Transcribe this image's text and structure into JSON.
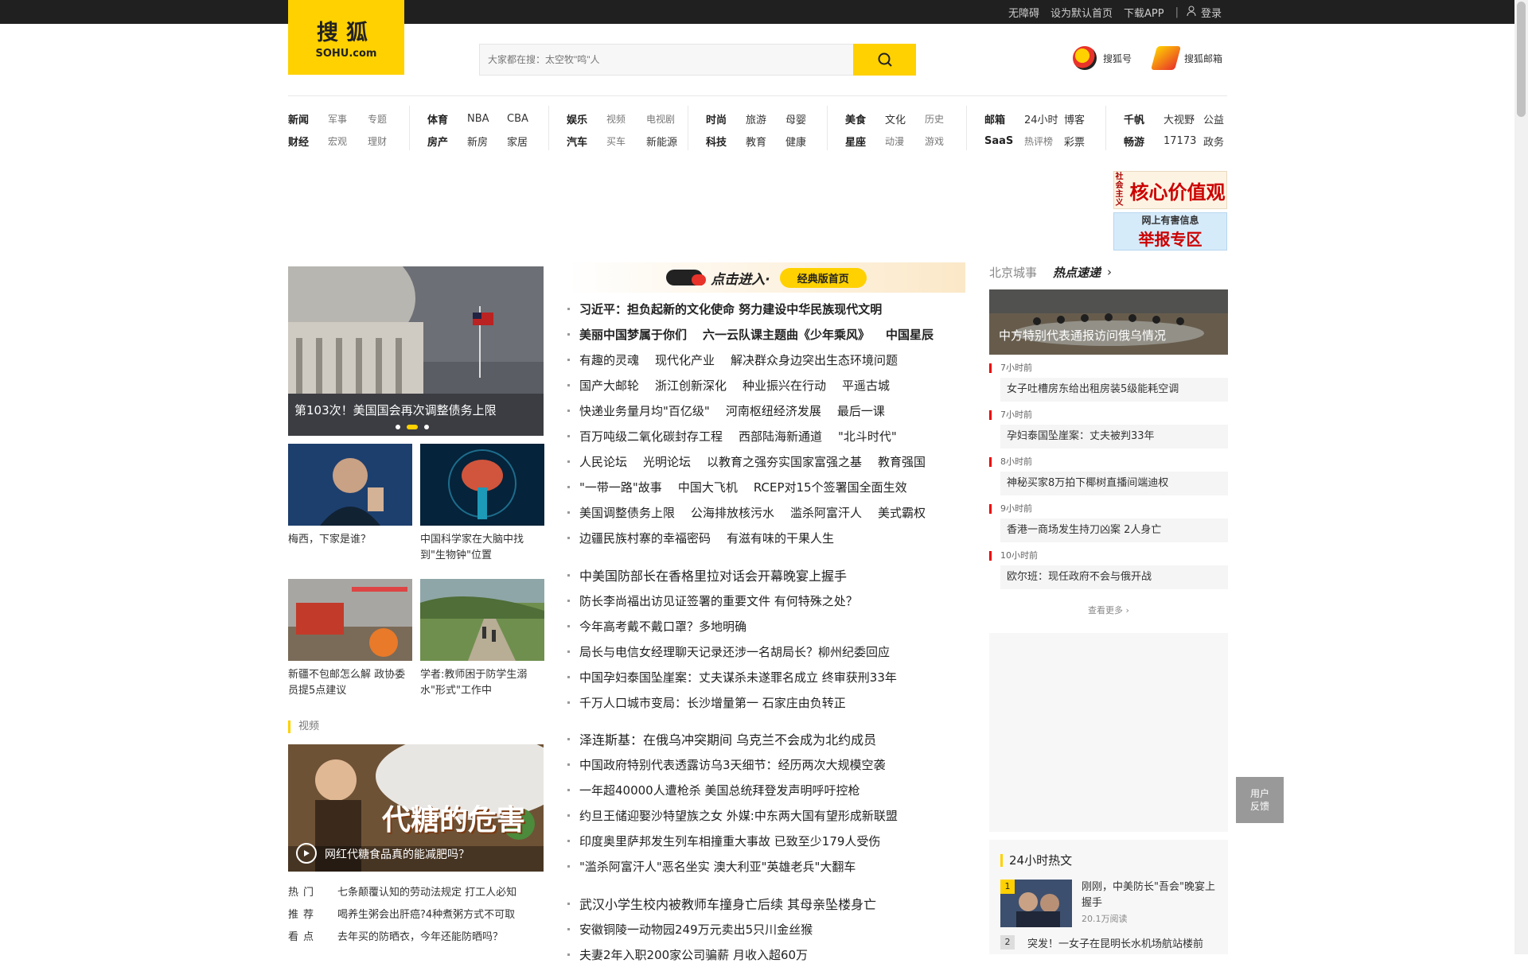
{
  "topbar": {
    "accessibility": "无障碍",
    "set_home": "设为默认首页",
    "download_app": "下载APP",
    "divider": "|",
    "login": "登录"
  },
  "logo": {
    "text": "搜狐",
    "sub": "SOHU.com"
  },
  "search": {
    "placeholder": "大家都在搜：太空牧\"鸣\"人",
    "icon": "search-icon"
  },
  "header_links": [
    {
      "label": "搜狐号",
      "icon": "sohu-hao-icon"
    },
    {
      "label": "搜狐邮箱",
      "icon": "sohu-mail-icon"
    }
  ],
  "nav": [
    [
      [
        "新闻",
        "军事",
        "专题"
      ],
      [
        "财经",
        "宏观",
        "理财"
      ]
    ],
    [
      [
        "体育",
        "NBA",
        "CBA"
      ],
      [
        "房产",
        "新房",
        "家居"
      ]
    ],
    [
      [
        "娱乐",
        "视频",
        "电视剧"
      ],
      [
        "汽车",
        "买车",
        "新能源"
      ]
    ],
    [
      [
        "时尚",
        "旅游",
        "母婴"
      ],
      [
        "科技",
        "教育",
        "健康"
      ]
    ],
    [
      [
        "美食",
        "文化",
        "历史"
      ],
      [
        "星座",
        "动漫",
        "游戏"
      ]
    ],
    [
      [
        "邮箱",
        "24小时",
        "博客"
      ],
      [
        "SaaS",
        "热评榜",
        "彩票"
      ]
    ],
    [
      [
        "千帆",
        "大视野",
        "公益"
      ],
      [
        "畅游",
        "17173",
        "政务"
      ]
    ]
  ],
  "banner": {
    "core_values": "核心价值观",
    "core_values_side": "社会主义",
    "report_small": "网上有害信息",
    "report_large": "举报专区"
  },
  "focus": {
    "caption": "第103次！美国国会再次调整债务上限",
    "colors": {
      "accent": "#ffd100"
    }
  },
  "thumbs": [
    {
      "title": "梅西，下家是谁？"
    },
    {
      "title": "中国科学家在大脑中找到\"生物钟\"位置"
    },
    {
      "title": "新疆不包邮怎么解 政协委员提5点建议"
    },
    {
      "title": "学者:教师困于防学生溺水\"形式\"工作中"
    }
  ],
  "video": {
    "section": "视频",
    "caption": "网红代糖食品真的能减肥吗？",
    "overlay_title": "代糖的危害"
  },
  "hot_list": [
    {
      "key": "热门",
      "title": "七条颠覆认知的劳动法规定 打工人必知"
    },
    {
      "key": "推荐",
      "title": "喝养生粥会出肝癌?4种煮粥方式不可取"
    },
    {
      "key": "看点",
      "title": "去年买的防晒衣，今年还能防晒吗？"
    }
  ],
  "center_banner": {
    "text": "点击进入·",
    "button": "经典版首页"
  },
  "news_group1": [
    [
      {
        "t": "习近平：担负起新的文化使命 努力建设中华民族现代文明",
        "b": true
      }
    ],
    [
      {
        "t": "美丽中国梦属于你们",
        "b": true
      },
      {
        "t": "六一云队课主题曲《少年乘风》",
        "b": true
      },
      {
        "t": "中国星辰",
        "b": true
      }
    ],
    [
      {
        "t": "有趣的灵魂"
      },
      {
        "t": "现代化产业"
      },
      {
        "t": "解决群众身边突出生态环境问题"
      }
    ],
    [
      {
        "t": "国产大邮轮"
      },
      {
        "t": "浙江创新深化"
      },
      {
        "t": "种业振兴在行动"
      },
      {
        "t": "平遥古城"
      }
    ],
    [
      {
        "t": "快递业务量月均\"百亿级\""
      },
      {
        "t": "河南枢纽经济发展"
      },
      {
        "t": "最后一课"
      }
    ],
    [
      {
        "t": "百万吨级二氧化碳封存工程"
      },
      {
        "t": "西部陆海新通道"
      },
      {
        "t": "\"北斗时代\""
      }
    ],
    [
      {
        "t": "人民论坛"
      },
      {
        "t": "光明论坛"
      },
      {
        "t": "以教育之强夯实国家富强之基"
      },
      {
        "t": "教育强国"
      }
    ],
    [
      {
        "t": "\"一带一路\"故事"
      },
      {
        "t": "中国大飞机"
      },
      {
        "t": "RCEP对15个签署国全面生效"
      }
    ],
    [
      {
        "t": "美国调整债务上限"
      },
      {
        "t": "公海排放核污水"
      },
      {
        "t": "滥杀阿富汗人"
      },
      {
        "t": "美式霸权"
      }
    ],
    [
      {
        "t": "边疆民族村寨的幸福密码"
      },
      {
        "t": "有滋有味的干果人生"
      }
    ]
  ],
  "news_group2": [
    "中美国防部长在香格里拉对话会开幕晚宴上握手",
    "防长李尚福出访见证签署的重要文件 有何特殊之处？",
    "今年高考戴不戴口罩？多地明确",
    "局长与电信女经理聊天记录还涉一名胡局长？柳州纪委回应",
    "中国孕妇泰国坠崖案：丈夫谋杀未遂罪名成立 终审获刑33年",
    "千万人口城市变局：长沙增量第一 石家庄由负转正"
  ],
  "news_group3": [
    "泽连斯基：在俄乌冲突期间 乌克兰不会成为北约成员",
    "中国政府特别代表透露访乌3天细节：经历两次大规模空袭",
    "一年超40000人遭枪杀 美国总统拜登发声明呼吁控枪",
    "约旦王储迎娶沙特望族之女 外媒:中东两大国有望形成新联盟",
    "印度奥里萨邦发生列车相撞重大事故 已致至少179人受伤",
    "\"滥杀阿富汗人\"恶名坐实 澳大利亚\"英雄老兵\"大翻车"
  ],
  "news_group4": [
    "武汉小学生校内被教师车撞身亡后续 其母亲坠楼身亡",
    "安徽铜陵一动物园249万元卖出5只川金丝猴",
    "夫妻2年入职200家公司骗薪 月收入超60万"
  ],
  "right": {
    "city": "北京城事",
    "hot_label": "热点速递",
    "head_caption": "中方特别代表通报访问俄乌情况",
    "items": [
      {
        "time": "7小时前",
        "title": "女子吐槽房东给出租房装5级能耗空调"
      },
      {
        "time": "7小时前",
        "title": "孕妇泰国坠崖案：丈夫被判33年"
      },
      {
        "time": "8小时前",
        "title": "神秘买家8万拍下椰树直播间端迪权"
      },
      {
        "time": "9小时前",
        "title": "香港一商场发生持刀凶案 2人身亡"
      },
      {
        "time": "10小时前",
        "title": "欧尔班：现任政府不会与俄开战"
      }
    ],
    "more": "查看更多"
  },
  "hot24": {
    "title": "24小时热文",
    "items": [
      {
        "rank": "1",
        "title": "刚刚，中美防长\"吾会\"晚宴上握手",
        "reads": "20.1万阅读"
      },
      {
        "rank": "2",
        "title": "突发！一女子在昆明长水机场航站楼前"
      }
    ]
  },
  "feedback": {
    "line1": "用户",
    "line2": "反馈"
  }
}
